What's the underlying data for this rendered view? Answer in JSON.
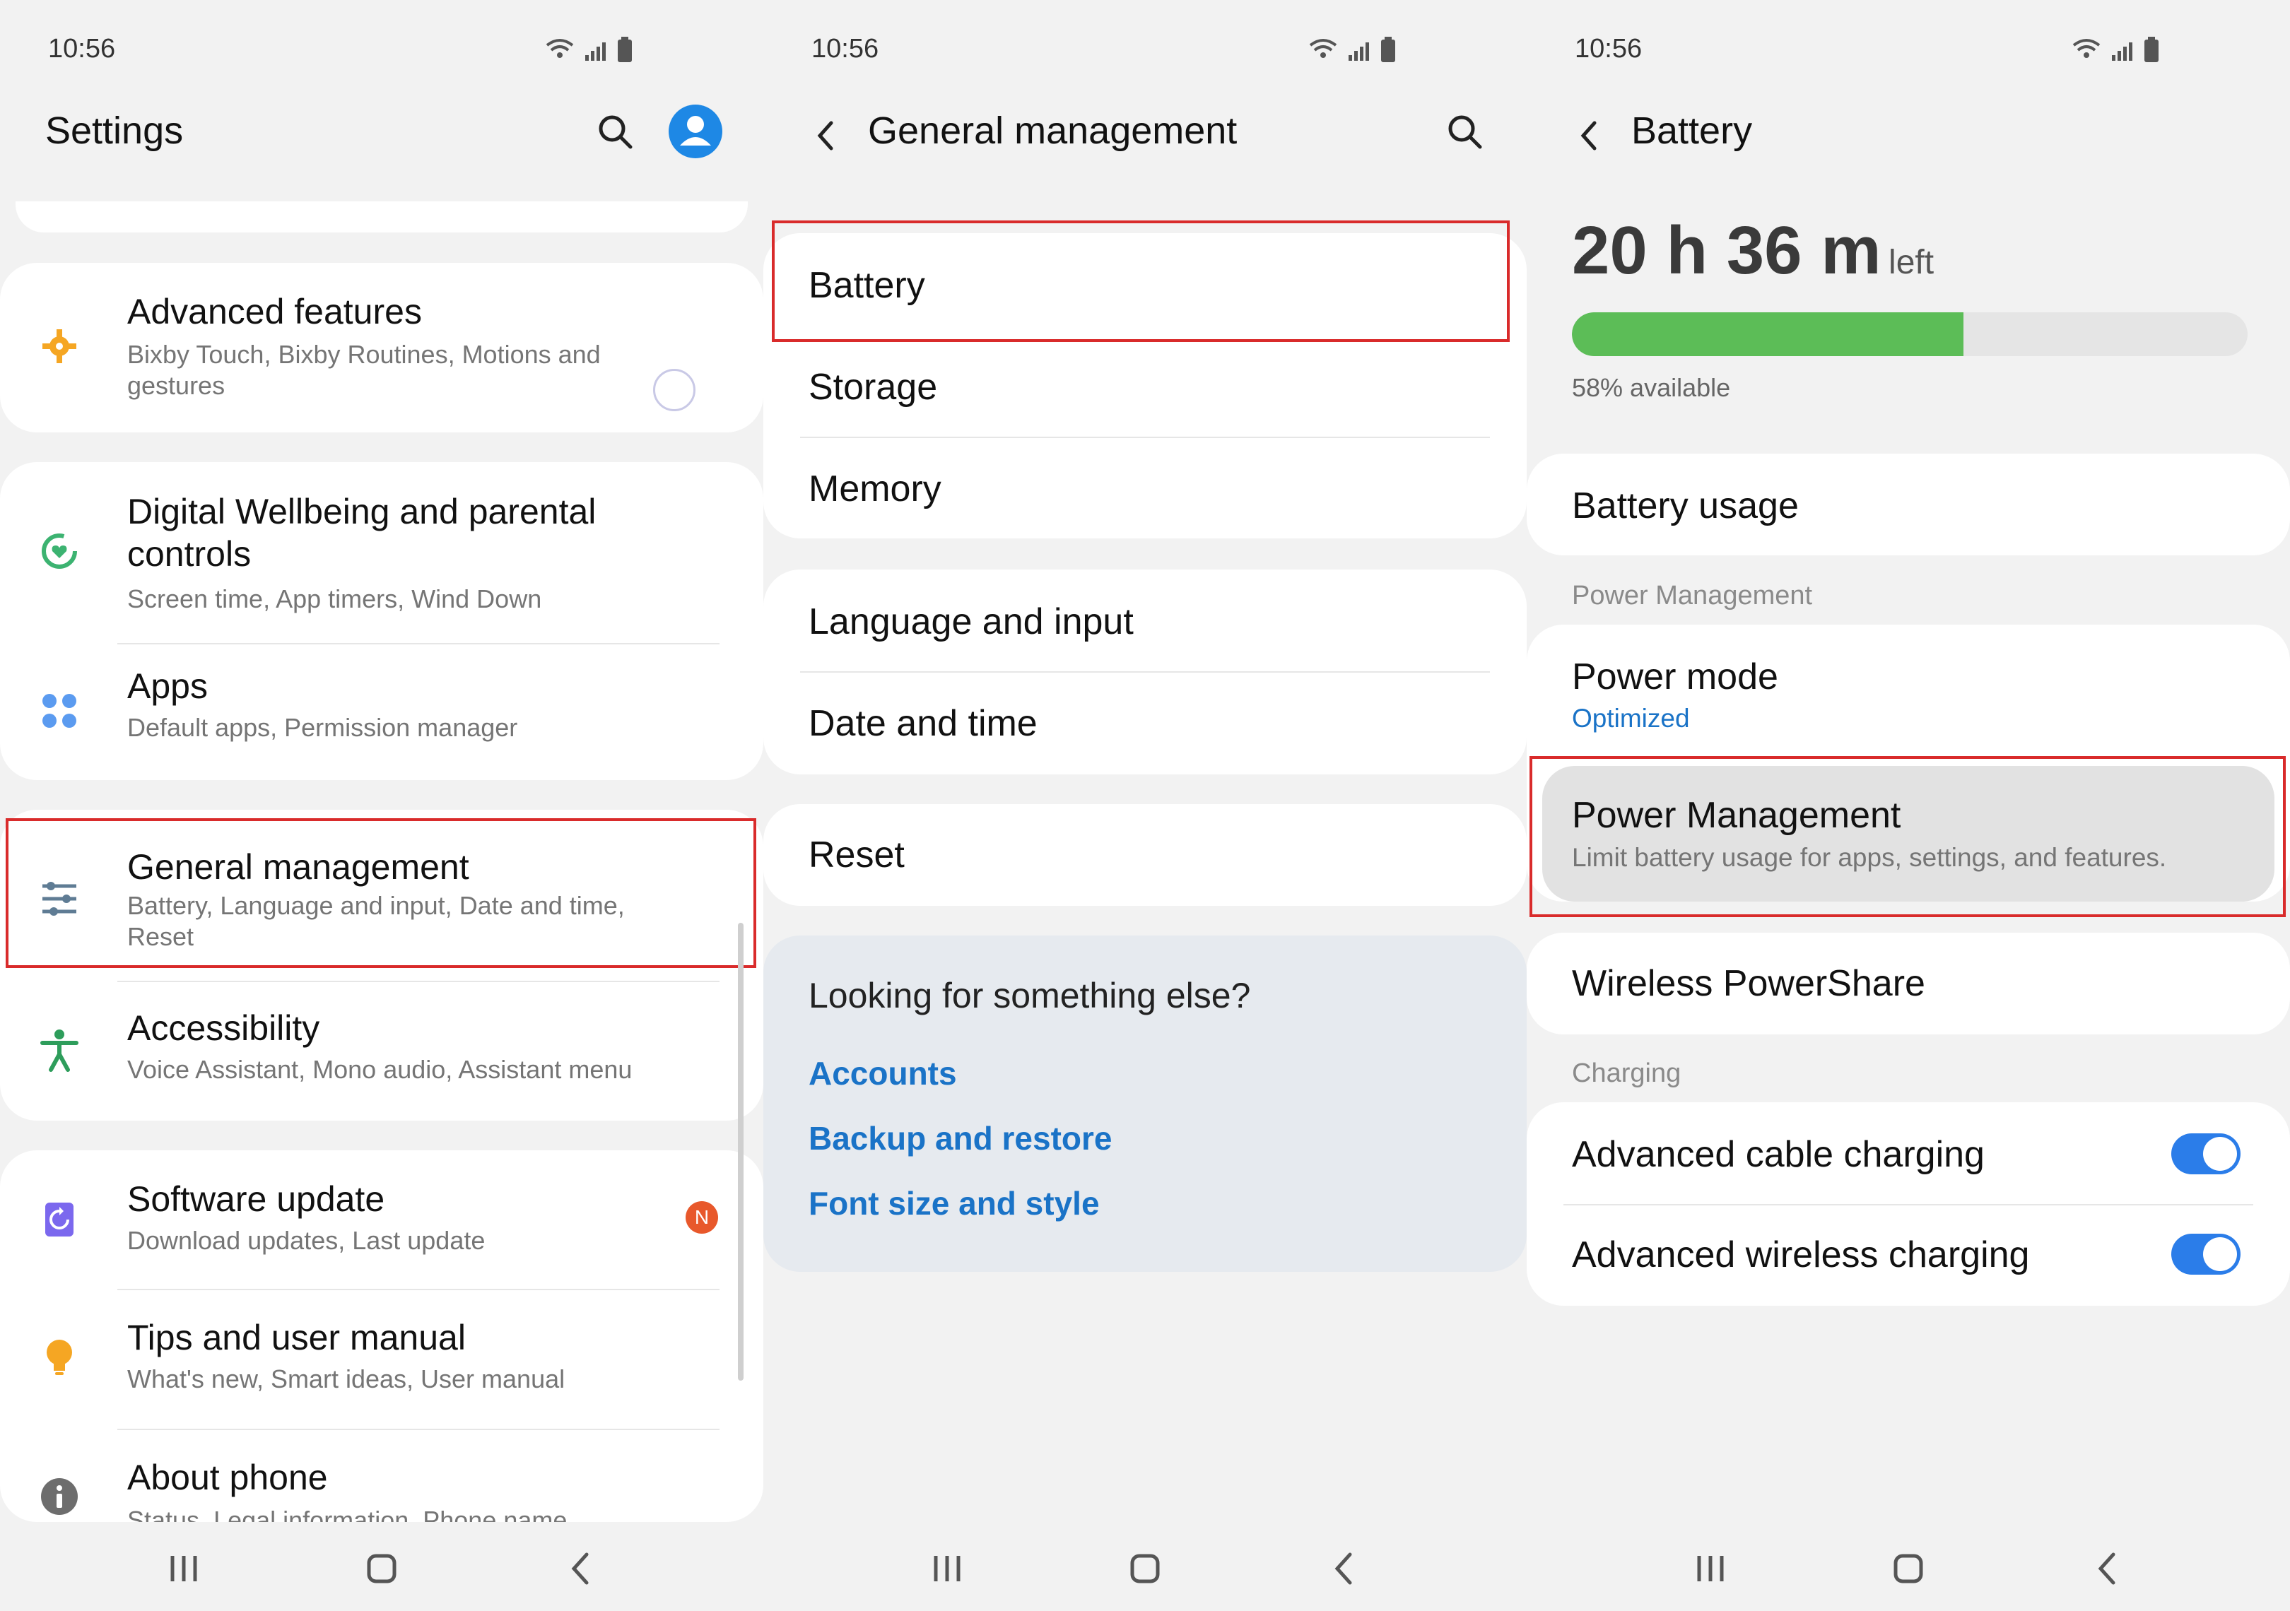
{
  "status_bar": {
    "time": "10:56"
  },
  "settings": {
    "title": "Settings",
    "items": [
      {
        "title": "Advanced features",
        "subtitle": "Bixby Touch, Bixby Routines, Motions and gestures"
      },
      {
        "title": "Digital Wellbeing and parental controls",
        "subtitle": "Screen time, App timers, Wind Down"
      },
      {
        "title": "Apps",
        "subtitle": "Default apps, Permission manager"
      },
      {
        "title": "General management",
        "subtitle": "Battery, Language and input, Date and time, Reset"
      },
      {
        "title": "Accessibility",
        "subtitle": "Voice Assistant, Mono audio, Assistant menu"
      },
      {
        "title": "Software update",
        "subtitle": "Download updates, Last update",
        "badge": "N"
      },
      {
        "title": "Tips and user manual",
        "subtitle": "What's new, Smart ideas, User manual"
      },
      {
        "title": "About phone",
        "subtitle": "Status, Legal information, Phone name"
      }
    ]
  },
  "general_management": {
    "title": "General management",
    "items": [
      "Battery",
      "Storage",
      "Memory",
      "Language and input",
      "Date and time",
      "Reset"
    ],
    "suggest": {
      "heading": "Looking for something else?",
      "links": [
        "Accounts",
        "Backup and restore",
        "Font size and style"
      ]
    }
  },
  "battery": {
    "title": "Battery",
    "time_left": "20 h 36 m",
    "left_word": "left",
    "available": "58% available",
    "level_fraction": 0.58,
    "usage": "Battery usage",
    "section_power": "Power Management",
    "power_mode": {
      "title": "Power mode",
      "value": "Optimized"
    },
    "power_management": {
      "title": "Power Management",
      "subtitle": "Limit battery usage for apps, settings, and features."
    },
    "wireless_powershare": "Wireless PowerShare",
    "section_charging": "Charging",
    "toggles": [
      {
        "label": "Advanced cable charging",
        "on": true
      },
      {
        "label": "Advanced wireless charging",
        "on": true
      }
    ]
  },
  "colors": {
    "highlight": "#d92b2b",
    "accent_blue": "#1a73c7",
    "battery_green": "#5cbd57",
    "toggle_on": "#2b7de9"
  }
}
